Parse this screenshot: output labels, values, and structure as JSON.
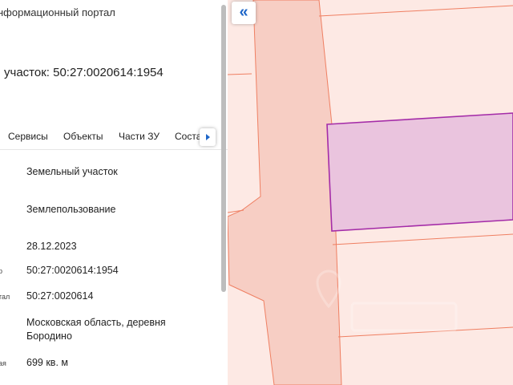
{
  "header": {
    "portal_title": "нформационный портал",
    "parcel_title": "участок: 50:27:0020614:1954"
  },
  "tabs": [
    "Сервисы",
    "Объекты",
    "Части ЗУ",
    "Соста"
  ],
  "rows": [
    {
      "label": "",
      "value": "Земельный участок"
    },
    {
      "label": "",
      "value": "Землепользование"
    },
    {
      "label": "",
      "value": "28.12.2023"
    },
    {
      "label": "р",
      "value": "50:27:0020614:1954"
    },
    {
      "label": "тал",
      "value": "50:27:0020614"
    },
    {
      "label": "",
      "value": "Московская область, деревня Бородино"
    },
    {
      "label": "ая",
      "value": "699 кв. м"
    }
  ],
  "map": {
    "collapse_icon": "double-chevron-left-icon",
    "colors": {
      "background": "#fde9e4",
      "road": "#f7cec4",
      "parcel_line": "#ef7f62",
      "selected_fill": "#eac4de",
      "selected_stroke": "#a42ca8",
      "accent": "#1e66c8"
    }
  }
}
